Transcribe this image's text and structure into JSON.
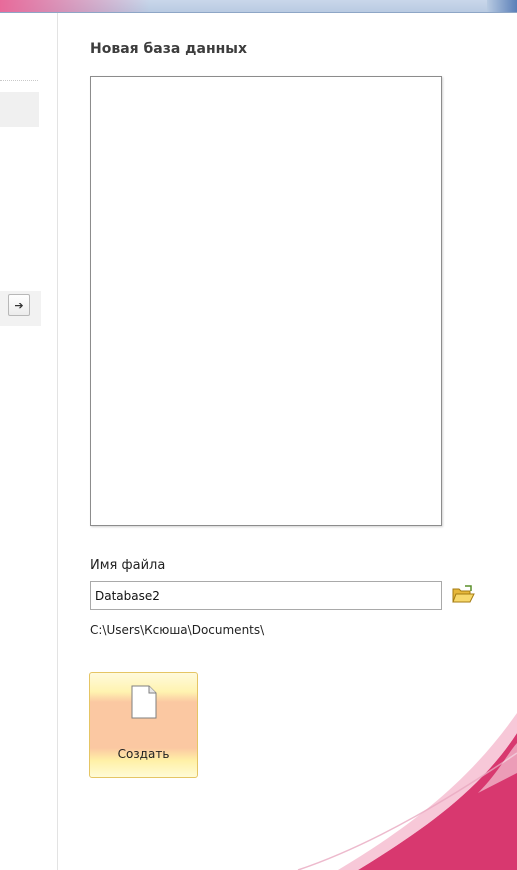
{
  "panel": {
    "title": "Новая база данных",
    "file_name_label": "Имя файла",
    "file_name_value": "Database2",
    "file_path": "C:\\Users\\Ксюша\\Documents\\",
    "create_label": "Создать"
  },
  "icons": {
    "go": "arrow-right-icon",
    "browse": "folder-open-icon",
    "create": "blank-document-icon"
  },
  "colors": {
    "accent_pink": "#d8386f",
    "create_button_fill": "#fbc8a2",
    "create_button_border": "#e5c564"
  }
}
